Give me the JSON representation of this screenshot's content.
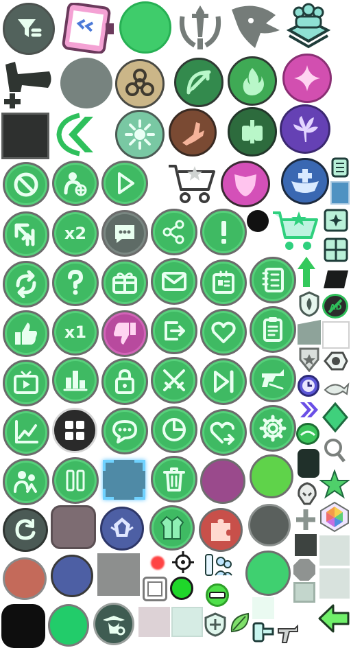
{
  "sheet": {
    "badges": {
      "double": "x2",
      "single": "x1"
    },
    "icons": [
      "filter-icon",
      "clipboard-icon",
      "green-circle-icon",
      "swords-crest-icon",
      "dragon-head-icon",
      "trophy-people-icon",
      "hammer-add-icon",
      "grey-circle-icon",
      "biohazard-icon",
      "bow-icon",
      "fire-icon",
      "sparkle-icon",
      "black-square-icon",
      "back-chevron-icon",
      "sun-icon",
      "claw-icon",
      "fist-icon",
      "tree-icon",
      "block-icon",
      "add-user-icon",
      "play-icon",
      "shop-cart-icon",
      "mask-icon",
      "heal-icon",
      "level-up-icon",
      "speed-x2-icon",
      "chat-icon",
      "share-icon",
      "alert-icon",
      "shop-cart-star-icon",
      "refresh-icon",
      "help-icon",
      "gift-icon",
      "mail-icon",
      "id-card-icon",
      "notebook-icon",
      "like-icon",
      "speed-x1-icon",
      "dislike-icon",
      "exit-icon",
      "heart-icon",
      "clipboard-list-icon",
      "tv-icon",
      "leaderboard-icon",
      "lock-icon",
      "crossed-swords-icon",
      "skip-icon",
      "gun-icon",
      "stats-icon",
      "menu-grid-icon",
      "chat-bubble-icon",
      "pie-chart-icon",
      "heart-share-icon",
      "settings-icon",
      "friends-icon",
      "pause-icon",
      "select-frame-icon",
      "trash-icon",
      "purple-circle-icon",
      "lime-circle-icon",
      "restart-icon",
      "mauve-square-icon",
      "crest-icon",
      "jacket-icon",
      "puzzle-icon",
      "dark-circle-icon"
    ],
    "colors": {
      "green": "#3fba63",
      "glyph": "#e8fff0",
      "ring": "#6b6b6b"
    }
  }
}
